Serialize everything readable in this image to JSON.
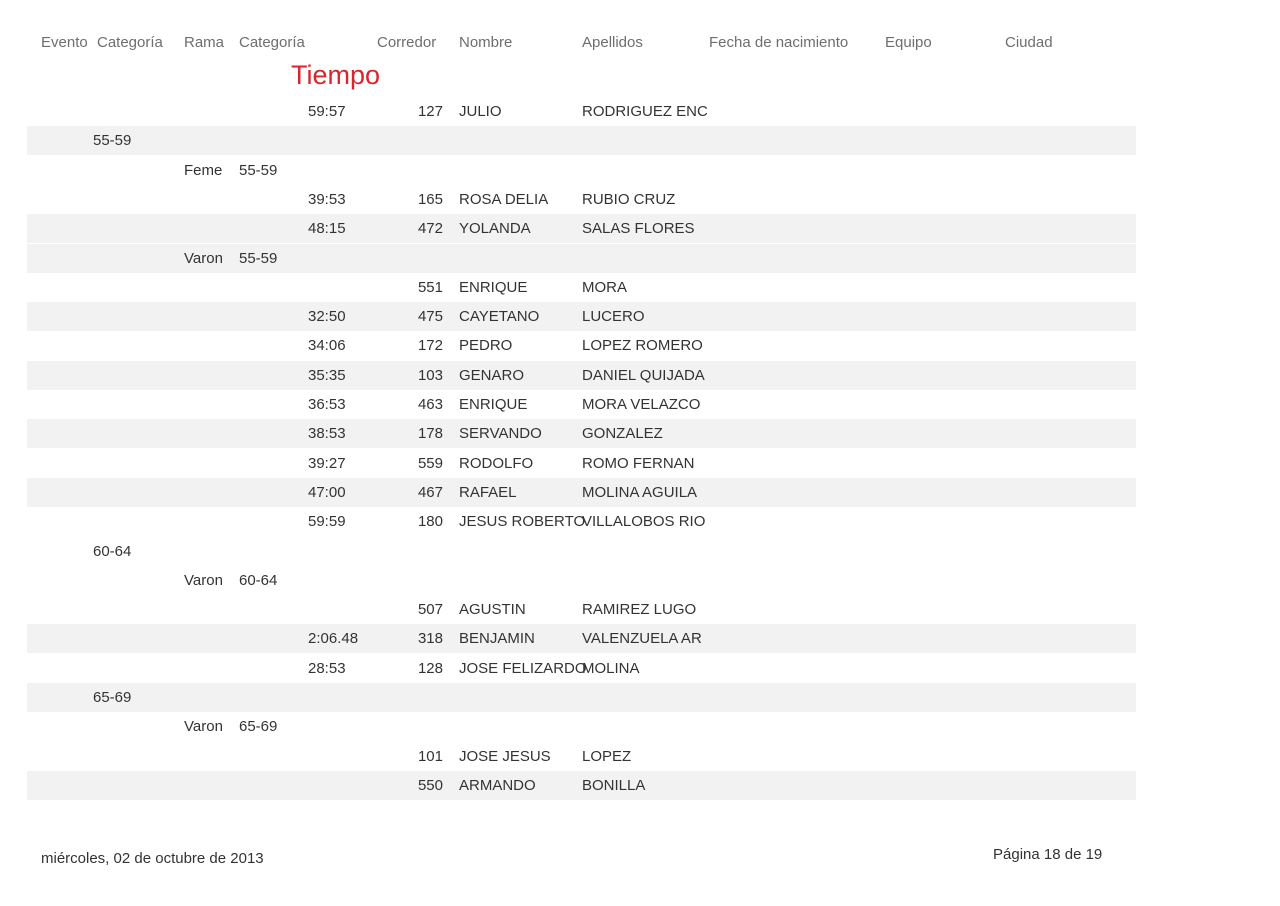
{
  "header": {
    "evento": "Evento",
    "categoria": "Categoría",
    "rama": "Rama",
    "categoria2": "Categoría",
    "corredor": "Corredor",
    "nombre": "Nombre",
    "apellidos": "Apellidos",
    "fecha": "Fecha de nacimiento",
    "equipo": "Equipo",
    "ciudad": "Ciudad",
    "tiempo": "Tiempo"
  },
  "rows": [
    {
      "cat": "",
      "rama": "",
      "cat2": "",
      "time": "59:57",
      "num": "127",
      "nombre": "JULIO",
      "apellidos": "RODRIGUEZ ENC",
      "shaded": false
    },
    {
      "cat": "55-59",
      "rama": "",
      "cat2": "",
      "time": "",
      "num": "",
      "nombre": "",
      "apellidos": "",
      "shaded": true
    },
    {
      "cat": "",
      "rama": "Feme",
      "cat2": "55-59",
      "time": "",
      "num": "",
      "nombre": "",
      "apellidos": "",
      "shaded": false
    },
    {
      "cat": "",
      "rama": "",
      "cat2": "",
      "time": "39:53",
      "num": "165",
      "nombre": "ROSA DELIA",
      "apellidos": "RUBIO CRUZ",
      "shaded": false
    },
    {
      "cat": "",
      "rama": "",
      "cat2": "",
      "time": "48:15",
      "num": "472",
      "nombre": "YOLANDA",
      "apellidos": "SALAS FLORES",
      "shaded": true
    },
    {
      "cat": "",
      "rama": "Varon",
      "cat2": "55-59",
      "time": "",
      "num": "",
      "nombre": "",
      "apellidos": "",
      "shaded": true
    },
    {
      "cat": "",
      "rama": "",
      "cat2": "",
      "time": "",
      "num": "551",
      "nombre": "ENRIQUE",
      "apellidos": "MORA",
      "shaded": false
    },
    {
      "cat": "",
      "rama": "",
      "cat2": "",
      "time": "32:50",
      "num": "475",
      "nombre": "CAYETANO",
      "apellidos": "LUCERO",
      "shaded": true
    },
    {
      "cat": "",
      "rama": "",
      "cat2": "",
      "time": "34:06",
      "num": "172",
      "nombre": "PEDRO",
      "apellidos": "LOPEZ ROMERO",
      "shaded": false
    },
    {
      "cat": "",
      "rama": "",
      "cat2": "",
      "time": "35:35",
      "num": "103",
      "nombre": "GENARO",
      "apellidos": "DANIEL QUIJADA",
      "shaded": true
    },
    {
      "cat": "",
      "rama": "",
      "cat2": "",
      "time": "36:53",
      "num": "463",
      "nombre": "ENRIQUE",
      "apellidos": "MORA VELAZCO",
      "shaded": false
    },
    {
      "cat": "",
      "rama": "",
      "cat2": "",
      "time": "38:53",
      "num": "178",
      "nombre": "SERVANDO",
      "apellidos": "GONZALEZ",
      "shaded": true
    },
    {
      "cat": "",
      "rama": "",
      "cat2": "",
      "time": "39:27",
      "num": "559",
      "nombre": "RODOLFO",
      "apellidos": "ROMO FERNAN",
      "shaded": false
    },
    {
      "cat": "",
      "rama": "",
      "cat2": "",
      "time": "47:00",
      "num": "467",
      "nombre": "RAFAEL",
      "apellidos": "MOLINA AGUILA",
      "shaded": true
    },
    {
      "cat": "",
      "rama": "",
      "cat2": "",
      "time": "59:59",
      "num": "180",
      "nombre": "JESUS ROBERTO",
      "apellidos": "VILLALOBOS RIO",
      "shaded": false
    },
    {
      "cat": "60-64",
      "rama": "",
      "cat2": "",
      "time": "",
      "num": "",
      "nombre": "",
      "apellidos": "",
      "shaded": false
    },
    {
      "cat": "",
      "rama": "Varon",
      "cat2": "60-64",
      "time": "",
      "num": "",
      "nombre": "",
      "apellidos": "",
      "shaded": false
    },
    {
      "cat": "",
      "rama": "",
      "cat2": "",
      "time": "",
      "num": "507",
      "nombre": "AGUSTIN",
      "apellidos": "RAMIREZ LUGO",
      "shaded": false
    },
    {
      "cat": "",
      "rama": "",
      "cat2": "",
      "time": "2:06.48",
      "num": "318",
      "nombre": "BENJAMIN",
      "apellidos": "VALENZUELA AR",
      "shaded": true
    },
    {
      "cat": "",
      "rama": "",
      "cat2": "",
      "time": "28:53",
      "num": "128",
      "nombre": "JOSE FELIZARDO",
      "apellidos": "MOLINA",
      "shaded": false
    },
    {
      "cat": "65-69",
      "rama": "",
      "cat2": "",
      "time": "",
      "num": "",
      "nombre": "",
      "apellidos": "",
      "shaded": true
    },
    {
      "cat": "",
      "rama": "Varon",
      "cat2": "65-69",
      "time": "",
      "num": "",
      "nombre": "",
      "apellidos": "",
      "shaded": false
    },
    {
      "cat": "",
      "rama": "",
      "cat2": "",
      "time": "",
      "num": "101",
      "nombre": "JOSE JESUS",
      "apellidos": "LOPEZ",
      "shaded": false
    },
    {
      "cat": "",
      "rama": "",
      "cat2": "",
      "time": "",
      "num": "550",
      "nombre": "ARMANDO",
      "apellidos": "BONILLA",
      "shaded": true
    }
  ],
  "footer": {
    "date": "miércoles, 02 de octubre de 2013",
    "page": "Página 18 de 19"
  }
}
